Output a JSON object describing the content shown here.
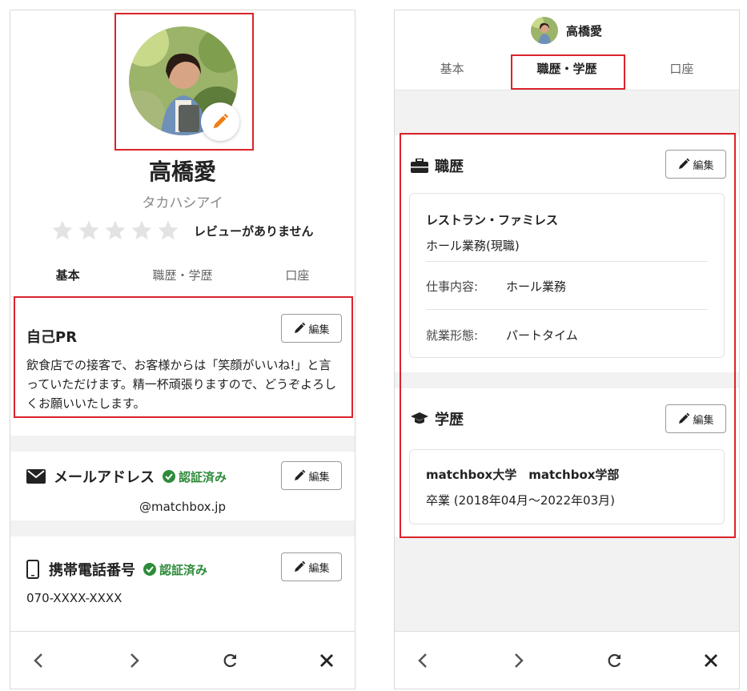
{
  "left": {
    "profile": {
      "name": "高橋愛",
      "kana": "タカハシアイ",
      "review_text": "レビューがありません",
      "stars": 5
    },
    "tabs": [
      {
        "label": "基本"
      },
      {
        "label": "職歴・学歴"
      },
      {
        "label": "口座"
      }
    ],
    "pr": {
      "title": "自己PR",
      "edit_label": "編集",
      "text": "飲食店での接客で、お客様からは「笑顔がいいね!」と言っていただけます。精一杯頑張りますので、どうぞよろしくお願いいたします。"
    },
    "email": {
      "title": "メールアドレス",
      "verified": "認証済み",
      "edit_label": "編集",
      "value": "@matchbox.jp"
    },
    "phone": {
      "title": "携帯電話番号",
      "verified": "認証済み",
      "edit_label": "編集",
      "value": "070-XXXX-XXXX"
    }
  },
  "right": {
    "header": {
      "name": "高橋愛"
    },
    "tabs": [
      {
        "label": "基本"
      },
      {
        "label": "職歴・学歴"
      },
      {
        "label": "口座"
      }
    ],
    "work": {
      "title": "職歴",
      "edit_label": "編集",
      "company": "レストラン・ファミレス",
      "role": "ホール業務(現職)",
      "duty_label": "仕事内容:",
      "duty_value": "ホール業務",
      "type_label": "就業形態:",
      "type_value": "パートタイム"
    },
    "education": {
      "title": "学歴",
      "edit_label": "編集",
      "school": "matchbox大学　matchbox学部",
      "status": "卒業 (2018年04月〜2022年03月)"
    }
  },
  "colors": {
    "accent_orange": "#f07d12",
    "verified_green": "#2e8b3a",
    "highlight_red": "#d9232a"
  }
}
